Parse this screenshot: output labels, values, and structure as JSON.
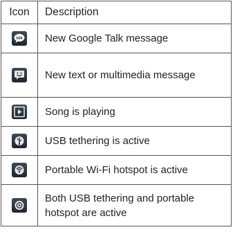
{
  "table": {
    "headers": {
      "icon": "Icon",
      "description": "Description"
    },
    "rows": [
      {
        "icon": "google-talk-icon",
        "description": "New Google Talk message"
      },
      {
        "icon": "text-multimedia-message-icon",
        "description": "New text or multimedia message"
      },
      {
        "icon": "song-playing-icon",
        "description": "Song is playing"
      },
      {
        "icon": "usb-tethering-icon",
        "description": "USB tethering is active"
      },
      {
        "icon": "wifi-hotspot-icon",
        "description": "Portable Wi-Fi hotspot is active"
      },
      {
        "icon": "usb-and-hotspot-icon",
        "description": "Both USB tethering and portable hotspot are active"
      }
    ]
  }
}
